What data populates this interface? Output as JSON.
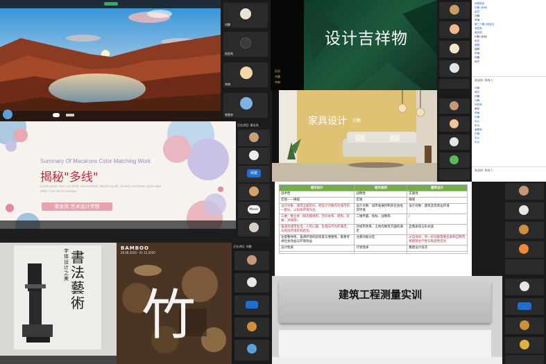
{
  "p1": {
    "side": [
      {
        "label": "刘静"
      },
      {
        "label": "闵亚鸣"
      },
      {
        "label": "李梅"
      },
      {
        "label": "曾晏林"
      }
    ]
  },
  "p2": {
    "title": "设计吉祥物",
    "side_names": [
      "彭凯",
      "刘静",
      "李梅",
      "闵亚鸣",
      "刘鹏",
      "闵亚鸣"
    ]
  },
  "p3": {
    "chat": [
      "远程参会",
      "刘静 (老师)",
      "全员",
      "刘静",
      "李梅",
      "第三十期小组会议",
      "闵亚鸣",
      "曾庆林",
      "刘静 (老师)",
      "彭凯",
      "超群",
      "超群",
      "李梅",
      "刘静",
      "邮件"
    ],
    "chat2": [
      "刘静",
      "邮件",
      "刘静",
      "刘静",
      "闵亚鸣",
      "邮件",
      "李梅",
      "刘静",
      "可以",
      "可以",
      "曾晏林",
      "刘静",
      "可以",
      "可以"
    ],
    "send": "发送给: 所有人"
  },
  "p4": {
    "title": "Summary Of Macarons Color Matching Work",
    "heading": "揭秘\"多线\"",
    "lorem": "Lorem ipsum dolor sit amet, consectetuer adipiscing elit. Aenean commodo ligula eget dolor. Cum sociis natoque.",
    "presenter": "秦金凤   艺术设计学院",
    "side_label": "正在讲话: 秦金凤",
    "side": [
      "刘静",
      "曾晏林",
      "李梅",
      "闵亚鸣",
      "刘静"
    ],
    "side_tags": [
      "闵建",
      "Mosen"
    ]
  },
  "p5": {
    "title": "家具设计",
    "name": "刘静",
    "side": [
      "刘静",
      "闵亚鸣",
      "刘静",
      "李梅",
      "闵亚鸣",
      "刘静"
    ]
  },
  "p6": {
    "headers": [
      "城市设计",
      "城市规划",
      "建筑设计"
    ],
    "rows": [
      [
        "战术性",
        "战略性",
        "实施性"
      ],
      [
        "宏观——微观",
        "宏观",
        "微观"
      ],
      [
        "设计对象：城市全部空间，把设计对象作为城市的一部分，以形体环境为主。",
        "设计对象：城市发展控制及社会经济环境",
        "设计对象：建筑及其周边环境"
      ],
      [
        "三维：重立体（如功能组织、空间关系、结构、轮廓、流线等）",
        "二维平面、指标、战略等",
        "/"
      ],
      [
        "强调对城市生活、人的心理、生理与行为的满足，与周边环境有机结合。",
        "对城市改革、土地均衡等方面的满足",
        "自我表现与形式美"
      ],
      [
        "注意整体性，强调环境的舒适度与便捷性，着重考虑社会效益与环境效益",
        "注重功能分区",
        "从自身的、单一的功能需要出发和自我完善建筑生产性与私密性空间"
      ],
      [
        "设计性质",
        "计划性质",
        "模建设计层次"
      ],
      [
        "",
        "",
        ""
      ]
    ],
    "side": [
      "刘静",
      "刘静",
      "闵亚鸣",
      "可能相同类型"
    ]
  },
  "p7": {
    "vertical": "字体设计之美",
    "big": "書法藝術",
    "side": [
      "刘静",
      "李梅",
      "闵亚鸣"
    ]
  },
  "p8": {
    "brand": "BAMBOO",
    "dates": "28.08.2020 - 01.12.2020",
    "char": "竹",
    "side_label": "正在讲话: 刘静",
    "side": [
      "刘静",
      "闵亚鸣",
      "李梅",
      "刘静"
    ]
  },
  "p9": {
    "title": "建筑工程测量实训",
    "side": [
      "刘静",
      "闵亚鸣",
      "李梅",
      "刘静"
    ]
  },
  "colors": {
    "accent_red": "#c0283a",
    "green_bar": "#2f8a3b"
  }
}
